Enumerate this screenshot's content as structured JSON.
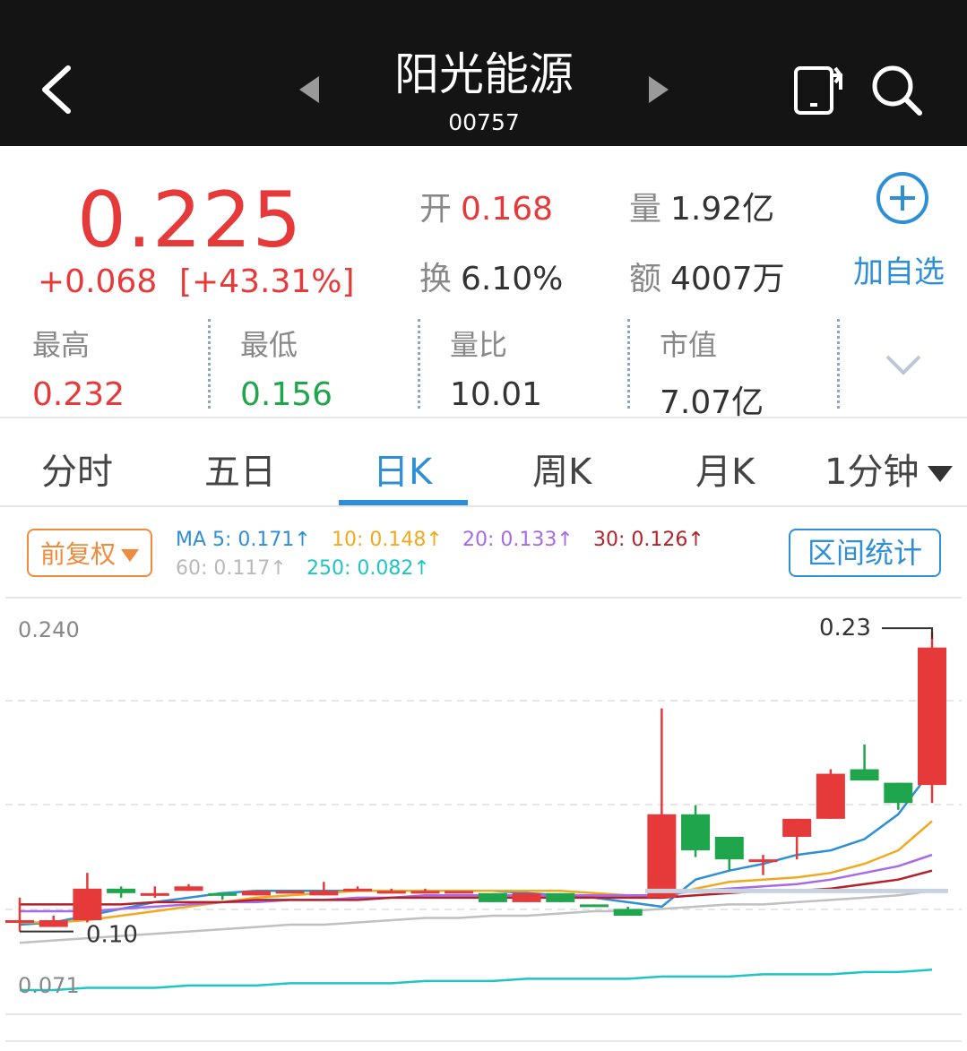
{
  "header": {
    "title": "阳光能源",
    "code": "00757"
  },
  "quote": {
    "price": "0.225",
    "change": "+0.068",
    "change_pct": "[+43.31%]",
    "open_label": "开",
    "open_value": "0.168",
    "volume_label": "量",
    "volume_value": "1.92亿",
    "turnover_label": "换",
    "turnover_value": "6.10%",
    "amount_label": "额",
    "amount_value": "4007万",
    "add_watchlist_label": "加自选"
  },
  "stats": [
    {
      "label": "最高",
      "value": "0.232",
      "color": "#e5393a"
    },
    {
      "label": "最低",
      "value": "0.156",
      "color": "#1fa54c"
    },
    {
      "label": "量比",
      "value": "10.01",
      "color": "#333333"
    },
    {
      "label": "市值",
      "value": "7.07亿",
      "color": "#333333"
    }
  ],
  "tabs": [
    "分时",
    "五日",
    "日K",
    "周K",
    "月K",
    "1分钟"
  ],
  "active_tab": "日K",
  "toolbar": {
    "adjust_label": "前复权",
    "range_stats_label": "区间统计",
    "ma": [
      {
        "text": "MA 5: 0.171↑",
        "color": "#2e8fd6"
      },
      {
        "text": "10: 0.148↑",
        "color": "#f0a91e"
      },
      {
        "text": "20: 0.133↑",
        "color": "#a66ae8"
      },
      {
        "text": "30: 0.126↑",
        "color": "#b3212a"
      },
      {
        "text": "60: 0.117↑",
        "color": "#b8b8b8"
      },
      {
        "text": "250: 0.082↑",
        "color": "#20c4c4"
      }
    ]
  },
  "chart_data": {
    "type": "candlestick",
    "y_top_label": "0.240",
    "y_bottom_label": "0.071",
    "ylim": [
      0.071,
      0.24
    ],
    "max_marker": "0.23",
    "min_marker": "0.10",
    "up_color": "#e5393a",
    "down_color": "#1fa54c",
    "candles": [
      {
        "o": 0.104,
        "h": 0.114,
        "l": 0.099,
        "c": 0.104
      },
      {
        "o": 0.101,
        "h": 0.106,
        "l": 0.101,
        "c": 0.104
      },
      {
        "o": 0.104,
        "h": 0.125,
        "l": 0.103,
        "c": 0.118
      },
      {
        "o": 0.118,
        "h": 0.119,
        "l": 0.114,
        "c": 0.116
      },
      {
        "o": 0.116,
        "h": 0.119,
        "l": 0.114,
        "c": 0.116
      },
      {
        "o": 0.117,
        "h": 0.12,
        "l": 0.117,
        "c": 0.119
      },
      {
        "o": 0.116,
        "h": 0.116,
        "l": 0.113,
        "c": 0.115
      },
      {
        "o": 0.115,
        "h": 0.117,
        "l": 0.115,
        "c": 0.117
      },
      {
        "o": 0.117,
        "h": 0.117,
        "l": 0.116,
        "c": 0.117
      },
      {
        "o": 0.115,
        "h": 0.121,
        "l": 0.115,
        "c": 0.117
      },
      {
        "o": 0.117,
        "h": 0.119,
        "l": 0.117,
        "c": 0.118
      },
      {
        "o": 0.117,
        "h": 0.118,
        "l": 0.116,
        "c": 0.117
      },
      {
        "o": 0.117,
        "h": 0.118,
        "l": 0.117,
        "c": 0.117
      },
      {
        "o": 0.117,
        "h": 0.117,
        "l": 0.117,
        "c": 0.117
      },
      {
        "o": 0.116,
        "h": 0.116,
        "l": 0.112,
        "c": 0.112
      },
      {
        "o": 0.112,
        "h": 0.116,
        "l": 0.112,
        "c": 0.116
      },
      {
        "o": 0.116,
        "h": 0.116,
        "l": 0.112,
        "c": 0.112
      },
      {
        "o": 0.111,
        "h": 0.111,
        "l": 0.11,
        "c": 0.11
      },
      {
        "o": 0.109,
        "h": 0.11,
        "l": 0.106,
        "c": 0.106
      },
      {
        "o": 0.114,
        "h": 0.198,
        "l": 0.114,
        "c": 0.151
      },
      {
        "o": 0.151,
        "h": 0.155,
        "l": 0.132,
        "c": 0.135
      },
      {
        "o": 0.141,
        "h": 0.141,
        "l": 0.126,
        "c": 0.131
      },
      {
        "o": 0.131,
        "h": 0.133,
        "l": 0.124,
        "c": 0.131
      },
      {
        "o": 0.141,
        "h": 0.149,
        "l": 0.131,
        "c": 0.149
      },
      {
        "o": 0.149,
        "h": 0.171,
        "l": 0.149,
        "c": 0.169
      },
      {
        "o": 0.171,
        "h": 0.182,
        "l": 0.167,
        "c": 0.166
      },
      {
        "o": 0.165,
        "h": 0.165,
        "l": 0.153,
        "c": 0.156
      },
      {
        "o": 0.164,
        "h": 0.232,
        "l": 0.156,
        "c": 0.225
      }
    ],
    "ma_series": [
      {
        "name": "MA5",
        "color": "#2e8fd6",
        "values": [
          0.102,
          0.103,
          0.106,
          0.109,
          0.112,
          0.114,
          0.116,
          0.117,
          0.117,
          0.117,
          0.117,
          0.117,
          0.117,
          0.117,
          0.117,
          0.116,
          0.115,
          0.114,
          0.112,
          0.11,
          0.122,
          0.126,
          0.129,
          0.133,
          0.135,
          0.14,
          0.151,
          0.171
        ]
      },
      {
        "name": "MA10",
        "color": "#f0a91e",
        "values": [
          0.103,
          0.103,
          0.104,
          0.106,
          0.108,
          0.11,
          0.112,
          0.114,
          0.115,
          0.116,
          0.117,
          0.117,
          0.117,
          0.117,
          0.117,
          0.117,
          0.117,
          0.116,
          0.115,
          0.114,
          0.118,
          0.121,
          0.122,
          0.123,
          0.125,
          0.129,
          0.135,
          0.148
        ]
      },
      {
        "name": "MA20",
        "color": "#a66ae8",
        "values": [
          0.108,
          0.108,
          0.108,
          0.109,
          0.11,
          0.111,
          0.112,
          0.112,
          0.113,
          0.113,
          0.114,
          0.114,
          0.115,
          0.115,
          0.115,
          0.115,
          0.115,
          0.115,
          0.115,
          0.115,
          0.117,
          0.118,
          0.119,
          0.12,
          0.122,
          0.125,
          0.128,
          0.133
        ]
      },
      {
        "name": "MA30",
        "color": "#b3212a",
        "values": [
          0.111,
          0.111,
          0.111,
          0.111,
          0.112,
          0.112,
          0.112,
          0.113,
          0.113,
          0.113,
          0.113,
          0.114,
          0.114,
          0.114,
          0.114,
          0.114,
          0.114,
          0.114,
          0.114,
          0.114,
          0.115,
          0.116,
          0.117,
          0.117,
          0.118,
          0.12,
          0.122,
          0.126
        ]
      },
      {
        "name": "MA60",
        "color": "#c0c0c0",
        "values": [
          0.094,
          0.095,
          0.096,
          0.097,
          0.098,
          0.099,
          0.1,
          0.101,
          0.102,
          0.102,
          0.103,
          0.104,
          0.105,
          0.105,
          0.106,
          0.106,
          0.107,
          0.108,
          0.108,
          0.109,
          0.11,
          0.111,
          0.111,
          0.112,
          0.113,
          0.114,
          0.115,
          0.117
        ]
      },
      {
        "name": "MA250",
        "color": "#20c4c4",
        "values": [
          0.073,
          0.073,
          0.074,
          0.074,
          0.074,
          0.075,
          0.075,
          0.075,
          0.076,
          0.076,
          0.076,
          0.076,
          0.077,
          0.077,
          0.077,
          0.078,
          0.078,
          0.078,
          0.078,
          0.079,
          0.079,
          0.079,
          0.08,
          0.08,
          0.08,
          0.081,
          0.081,
          0.082
        ]
      }
    ]
  }
}
